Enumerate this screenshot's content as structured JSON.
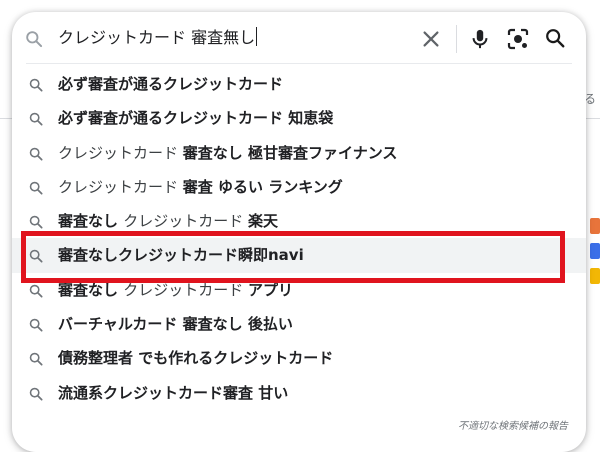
{
  "search": {
    "query": "クレジットカード 審査無し"
  },
  "suggestions": [
    {
      "parts": [
        {
          "text": "必ず審査が通るクレジットカード",
          "bold": true
        }
      ],
      "highlighted": false
    },
    {
      "parts": [
        {
          "text": "必ず審査が通るクレジットカード 知恵袋",
          "bold": true
        }
      ],
      "highlighted": false
    },
    {
      "parts": [
        {
          "text": "クレジットカード ",
          "bold": false
        },
        {
          "text": "審査なし 極甘審査ファイナンス",
          "bold": true
        }
      ],
      "highlighted": false
    },
    {
      "parts": [
        {
          "text": "クレジットカード ",
          "bold": false
        },
        {
          "text": "審査 ゆるい ランキング",
          "bold": true
        }
      ],
      "highlighted": false
    },
    {
      "parts": [
        {
          "text": "審査なし ",
          "bold": true
        },
        {
          "text": "クレジットカード ",
          "bold": false
        },
        {
          "text": "楽天",
          "bold": true
        }
      ],
      "highlighted": false
    },
    {
      "parts": [
        {
          "text": "審査なしクレジットカード瞬即navi",
          "bold": true
        }
      ],
      "highlighted": true
    },
    {
      "parts": [
        {
          "text": "審査なし ",
          "bold": true
        },
        {
          "text": "クレジットカード ",
          "bold": false
        },
        {
          "text": "アプリ",
          "bold": true
        }
      ],
      "highlighted": false
    },
    {
      "parts": [
        {
          "text": "バーチャルカード 審査なし 後払い",
          "bold": true
        }
      ],
      "highlighted": false
    },
    {
      "parts": [
        {
          "text": "債務整理者 でも作れるクレジットカード",
          "bold": true
        }
      ],
      "highlighted": false
    },
    {
      "parts": [
        {
          "text": "流通系クレジットカード審査 甘い",
          "bold": true
        }
      ],
      "highlighted": false
    }
  ],
  "report_link": "不適切な検索候補の報告",
  "background": {
    "partial_text": "る"
  },
  "colors": {
    "highlight_border": "#e0141e",
    "row_hover": "#f1f3f4",
    "icon_gray": "#5f6368"
  },
  "icons": {
    "search": "search-icon",
    "clear": "close-icon",
    "voice": "mic-icon",
    "image_search": "camera-lens-icon"
  }
}
